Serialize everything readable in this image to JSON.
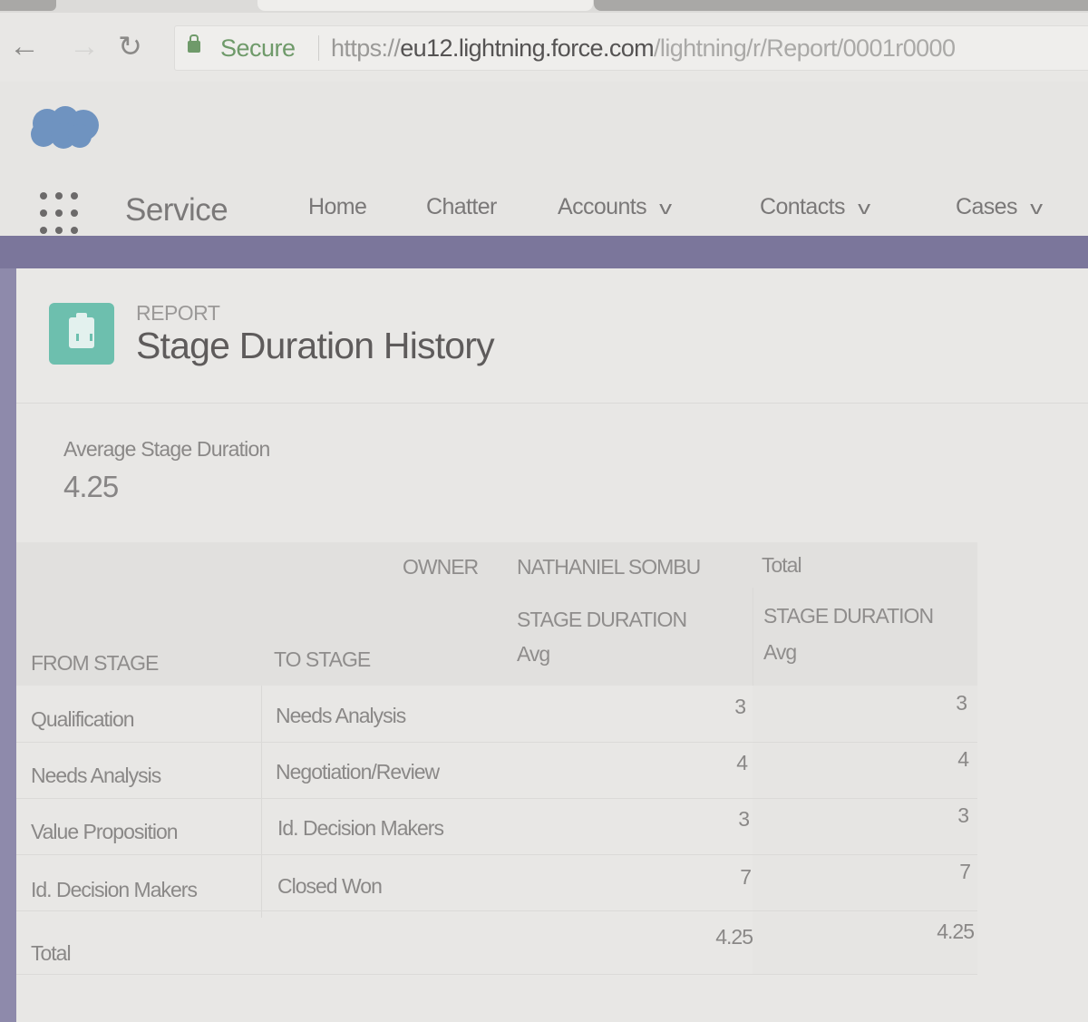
{
  "browser": {
    "back_icon": "arrow-left",
    "forward_icon": "arrow-right",
    "reload_icon": "reload",
    "secure_label": "Secure",
    "url_scheme": "https://",
    "url_host": "eu12.lightning.force.com",
    "url_path": "/lightning/r/Report/0001r0000"
  },
  "header": {
    "logo": "salesforce-cloud-logo",
    "app_launcher_icon": "app-launcher-grid",
    "app_name": "Service",
    "nav": [
      {
        "label": "Home",
        "has_menu": false
      },
      {
        "label": "Chatter",
        "has_menu": false
      },
      {
        "label": "Accounts",
        "has_menu": true
      },
      {
        "label": "Contacts",
        "has_menu": true
      },
      {
        "label": "Cases",
        "has_menu": true
      }
    ],
    "chevron": "⌄"
  },
  "colors": {
    "brand_band": "#7b769b",
    "report_icon": "#6dbfae",
    "logo": "#6f93c0"
  },
  "report": {
    "object_type": "REPORT",
    "title": "Stage Duration History",
    "metric_label": "Average Stage Duration",
    "metric_value": "4.25"
  },
  "table": {
    "owner_label": "OWNER",
    "owner_name": "NATHANIEL SOMBU",
    "total_group_label": "Total",
    "columns": {
      "from_stage": "FROM STAGE",
      "to_stage": "TO STAGE",
      "measure": "STAGE DURATION",
      "aggregate": "Avg"
    },
    "rows": [
      {
        "from": "Qualification",
        "to": "Needs Analysis",
        "owner_avg": "3",
        "total_avg": "3"
      },
      {
        "from": "Needs Analysis",
        "to": "Negotiation/Review",
        "owner_avg": "4",
        "total_avg": "4"
      },
      {
        "from": "Value Proposition",
        "to": "Id. Decision Makers",
        "owner_avg": "3",
        "total_avg": "3"
      },
      {
        "from": "Id. Decision Makers",
        "to": "Closed Won",
        "owner_avg": "7",
        "total_avg": "7"
      }
    ],
    "total_row": {
      "label": "Total",
      "owner_avg": "4.25",
      "total_avg": "4.25"
    }
  }
}
